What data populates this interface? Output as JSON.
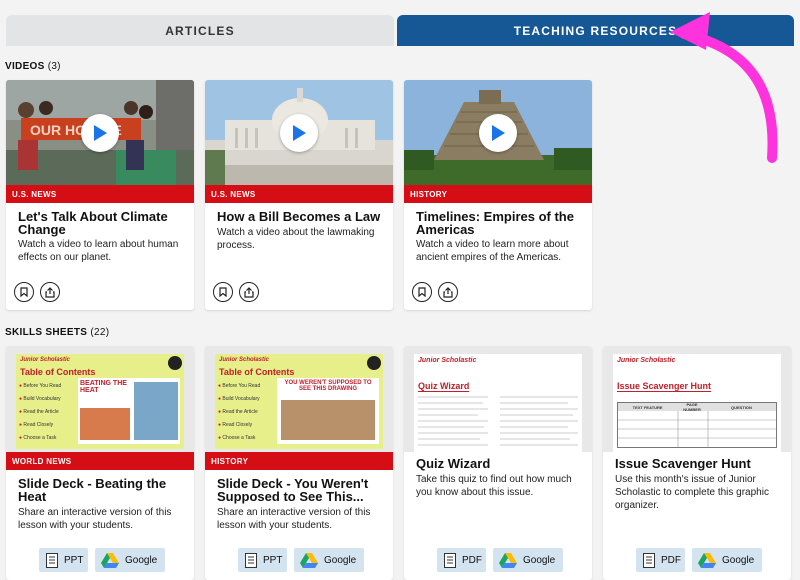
{
  "tabs": {
    "articles": "ARTICLES",
    "teaching": "TEACHING RESOURCES"
  },
  "videos": {
    "label": "VIDEOS",
    "count": "(3)",
    "items": [
      {
        "category": "U.S. NEWS",
        "title": "Let's Talk About Climate Change",
        "desc": "Watch a video to learn about human effects on our planet."
      },
      {
        "category": "U.S. NEWS",
        "title": "How a Bill Becomes a Law",
        "desc": "Watch a video about the lawmaking process."
      },
      {
        "category": "HISTORY",
        "title": "Timelines: Empires of the Americas",
        "desc": "Watch a video to learn more about ancient empires of the Americas."
      }
    ]
  },
  "skills": {
    "label": "SKILLS SHEETS",
    "count": "(22)",
    "items": [
      {
        "category": "WORLD NEWS",
        "title": "Slide Deck - Beating the Heat",
        "desc": "Share an interactive version of this lesson with your students.",
        "file_label": "PPT",
        "google_label": "Google",
        "thumb_brand": "Junior Scholastic",
        "thumb_heading": "Table of Contents",
        "thumb_headline": "BEATING THE HEAT",
        "thumb_steps": [
          "Before You Read",
          "Build Vocabulary",
          "Read the Article",
          "Read Closely",
          "Choose a Task"
        ]
      },
      {
        "category": "HISTORY",
        "title": "Slide Deck - You Weren't Supposed to See This...",
        "desc": "Share an interactive version of this lesson with your students.",
        "file_label": "PPT",
        "google_label": "Google",
        "thumb_brand": "Junior Scholastic",
        "thumb_heading": "Table of Contents",
        "thumb_headline": "YOU WEREN'T SUPPOSED TO SEE THIS DRAWING",
        "thumb_steps": [
          "Before You Read",
          "Build Vocabulary",
          "Read the Article",
          "Read Closely",
          "Choose a Task"
        ]
      },
      {
        "category": "",
        "title": "Quiz Wizard",
        "desc": "Take this quiz to find out how much you know about this issue.",
        "file_label": "PDF",
        "google_label": "Google",
        "thumb_brand": "Junior Scholastic",
        "thumb_heading": "Quiz Wizard"
      },
      {
        "category": "",
        "title": "Issue Scavenger Hunt",
        "desc": "Use this month's issue of Junior Scholastic to complete this graphic organizer.",
        "file_label": "PDF",
        "google_label": "Google",
        "thumb_brand": "Junior Scholastic",
        "thumb_heading": "Issue Scavenger Hunt",
        "thumb_cols": [
          "TEXT FEATURE",
          "PAGE NUMBER",
          "QUESTION"
        ]
      }
    ]
  },
  "colors": {
    "tab_active": "#165896",
    "category_bar": "#d40e14",
    "play_icon": "#1a73e8",
    "file_button": "#d3e4f0",
    "annotation_arrow": "#ff33dd"
  }
}
